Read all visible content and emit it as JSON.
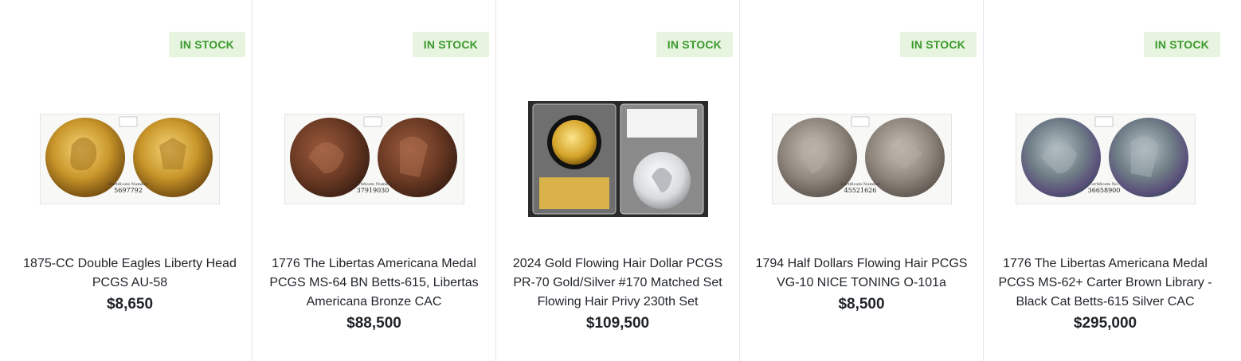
{
  "products": [
    {
      "badge": "IN STOCK",
      "title": "1875-CC Double Eagles Liberty Head PCGS AU-58",
      "price": "$8,650",
      "cert": "5697792",
      "cert_label": "Certificate Number"
    },
    {
      "badge": "IN STOCK",
      "title": "1776 The Libertas Americana Medal PCGS MS-64 BN Betts-615, Libertas Americana Bronze CAC",
      "price": "$88,500",
      "cert": "37919030",
      "cert_label": "Certificate Number"
    },
    {
      "badge": "IN STOCK",
      "title": "2024 Gold Flowing Hair Dollar PCGS PR-70 Gold/Silver #170 Matched Set Flowing Hair Privy 230th Set",
      "price": "$109,500"
    },
    {
      "badge": "IN STOCK",
      "title": "1794 Half Dollars Flowing Hair PCGS VG-10 NICE TONING O-101a",
      "price": "$8,500",
      "cert": "45521626",
      "cert_label": "Certificate Number"
    },
    {
      "badge": "IN STOCK",
      "title": "1776 The Libertas Americana Medal PCGS MS-62+ Carter Brown Library - Black Cat Betts-615 Silver CAC",
      "price": "$295,000",
      "cert": "36658900",
      "cert_label": "Certificate No."
    }
  ],
  "colors": {
    "badge_bg": "#e7f4df",
    "badge_text": "#3c9a2e"
  }
}
